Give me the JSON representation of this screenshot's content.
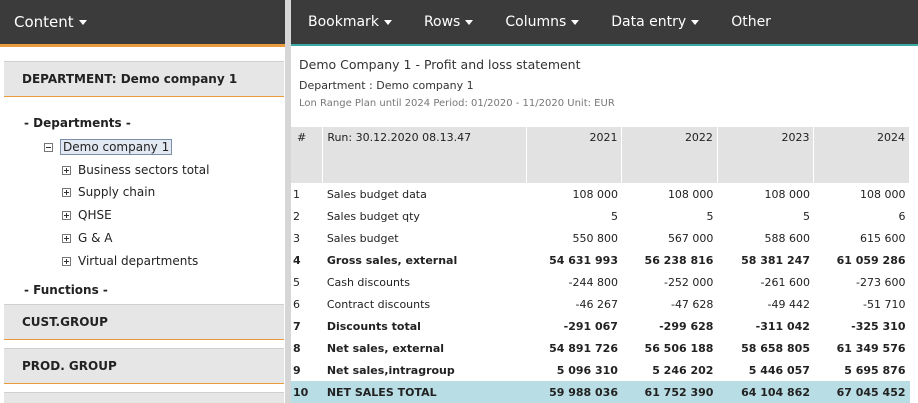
{
  "left_panel": {
    "menu_label": "Content",
    "department_section": "DEPARTMENT: Demo company 1",
    "tree": {
      "departments_heading": "- Departments -",
      "root": "Demo company 1",
      "children": [
        "Business sectors total",
        "Supply chain",
        "QHSE",
        "G & A",
        "Virtual departments"
      ],
      "functions_heading": "- Functions -"
    },
    "cust_group_section": "CUST.GROUP",
    "prod_group_section": "PROD. GROUP"
  },
  "menubar": {
    "items": [
      "Bookmark",
      "Rows",
      "Columns",
      "Data entry",
      "Other"
    ]
  },
  "report": {
    "title": "Demo Company 1 - Profit and loss statement",
    "department": "Department : Demo company 1",
    "plan_info": "Lon Range Plan until 2024 Period: 01/2020 - 11/2020 Unit: EUR",
    "header": {
      "index": "#",
      "run": "Run: 30.12.2020 08.13.47",
      "years": [
        "2021",
        "2022",
        "2023",
        "2024"
      ]
    },
    "rows": [
      {
        "idx": "1",
        "label": "Sales budget data",
        "values": [
          "108 000",
          "108 000",
          "108 000",
          "108 000"
        ],
        "bold": false
      },
      {
        "idx": "2",
        "label": "Sales budget qty",
        "values": [
          "5",
          "5",
          "5",
          "6"
        ],
        "bold": false
      },
      {
        "idx": "3",
        "label": "Sales budget",
        "values": [
          "550 800",
          "567 000",
          "588 600",
          "615 600"
        ],
        "bold": false
      },
      {
        "idx": "4",
        "label": "Gross sales, external",
        "values": [
          "54 631 993",
          "56 238 816",
          "58 381 247",
          "61 059 286"
        ],
        "bold": true
      },
      {
        "idx": "5",
        "label": "Cash discounts",
        "values": [
          "-244 800",
          "-252 000",
          "-261 600",
          "-273 600"
        ],
        "bold": false
      },
      {
        "idx": "6",
        "label": "Contract discounts",
        "values": [
          "-46 267",
          "-47 628",
          "-49 442",
          "-51 710"
        ],
        "bold": false
      },
      {
        "idx": "7",
        "label": "Discounts total",
        "values": [
          "-291 067",
          "-299 628",
          "-311 042",
          "-325 310"
        ],
        "bold": true
      },
      {
        "idx": "8",
        "label": "Net sales, external",
        "values": [
          "54 891 726",
          "56 506 188",
          "58 658 805",
          "61 349 576"
        ],
        "bold": true
      },
      {
        "idx": "9",
        "label": "Net sales,intragroup",
        "values": [
          "5 096 310",
          "5 246 202",
          "5 446 057",
          "5 695 876"
        ],
        "bold": true
      },
      {
        "idx": "10",
        "label": "NET SALES TOTAL",
        "values": [
          "59 988 036",
          "61 752 390",
          "64 104 862",
          "67 045 452"
        ],
        "bold": true,
        "total": true
      }
    ]
  },
  "colors": {
    "menubar_bg": "#3b3b3b",
    "orange_accent": "#e89a3c",
    "teal_accent": "#3aaaa6",
    "total_row_bg": "#b9dde4"
  }
}
